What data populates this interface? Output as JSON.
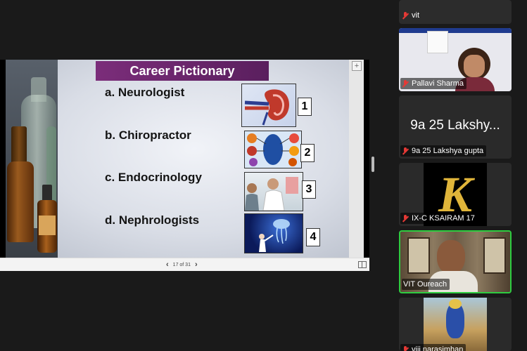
{
  "slide": {
    "title": "Career Pictionary",
    "items": [
      {
        "text": "a. Neurologist",
        "number": "1"
      },
      {
        "text": "b. Chiropractor",
        "number": "2"
      },
      {
        "text": "c. Endocrinology",
        "number": "3"
      },
      {
        "text": "d. Nephrologists",
        "number": "4"
      }
    ],
    "page_indicator": "17 of 31",
    "prev_icon": "‹",
    "next_icon": "›"
  },
  "participants": [
    {
      "name": "vit",
      "mic": "muted"
    },
    {
      "name": "Pallavi Sharma",
      "mic": "muted"
    },
    {
      "name": "9a 25 Lakshya gupta",
      "display": "9a 25 Lakshy...",
      "mic": "muted"
    },
    {
      "name": "IX-C KSAIRAM 17",
      "mic": "muted"
    },
    {
      "name": "VIT Oureach",
      "mic": "on",
      "speaking": true
    },
    {
      "name": "viji narasimhan",
      "mic": "muted"
    }
  ],
  "colors": {
    "title_bar": "#7b2d7a",
    "active_speaker": "#2ecc40",
    "muted": "#e53935"
  }
}
